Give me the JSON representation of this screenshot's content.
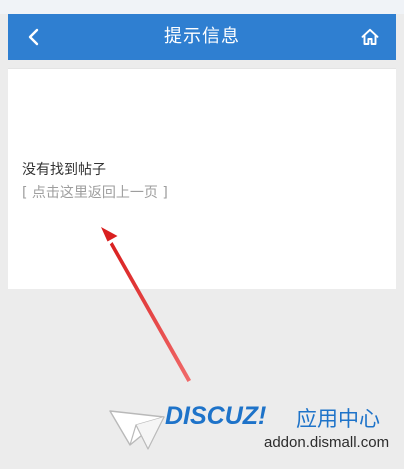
{
  "header": {
    "title": "提示信息",
    "back_icon": "chevron-left-icon",
    "home_icon": "home-icon",
    "background": "#2f7fd1"
  },
  "content": {
    "message": "没有找到帖子",
    "back_link": "[ 点击这里返回上一页 ]"
  },
  "annotation": {
    "arrow_color": "#e02a2a"
  },
  "watermark": {
    "brand": "DISCUZ!",
    "brand_cn": "应用中心",
    "domain": "addon.dismall.com",
    "logo_icon": "paper-plane-icon",
    "color": "#1e73c9"
  }
}
